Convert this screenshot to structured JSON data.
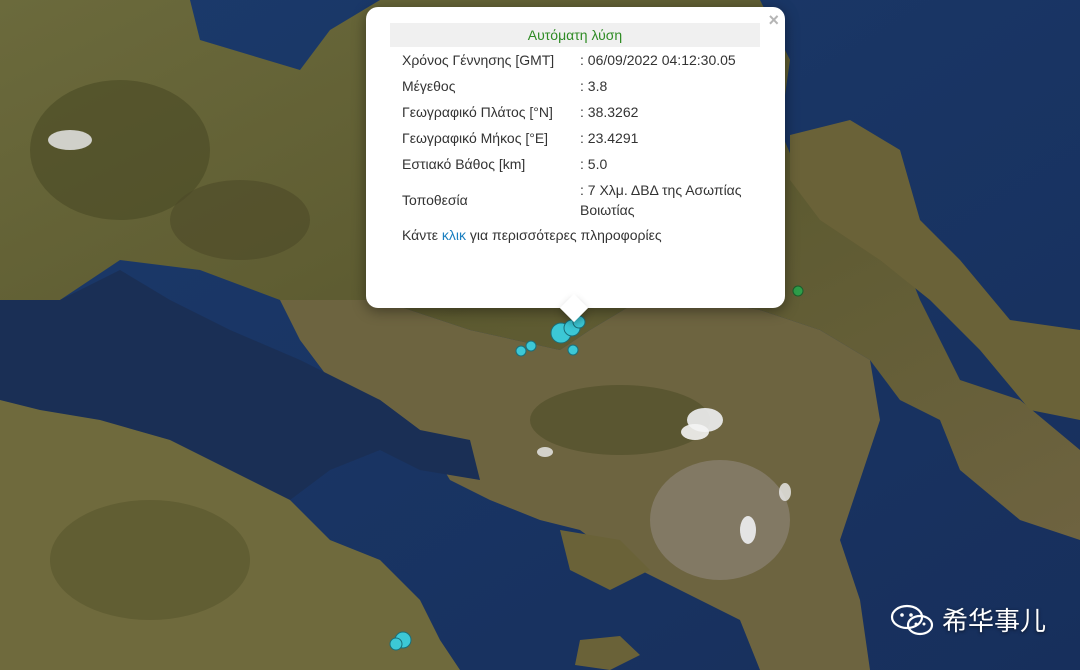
{
  "popup": {
    "header": "Αυτόματη λύση",
    "close_symbol": "×",
    "rows": [
      {
        "label": "Χρόνος Γέννησης [GMT]",
        "value": ": 06/09/2022 04:12:30.05"
      },
      {
        "label": "Μέγεθος",
        "value": ": 3.8"
      },
      {
        "label": "Γεωγραφικό Πλάτος [°N]",
        "value": ": 38.3262"
      },
      {
        "label": "Γεωγραφικό Μήκος [°E]",
        "value": ": 23.4291"
      },
      {
        "label": "Εστιακό Βάθος [km]",
        "value": ": 5.0"
      },
      {
        "label": "Τοποθεσία",
        "value": ": 7 Χλμ. ΔΒΔ της Ασωπίας Βοιωτίας"
      }
    ],
    "more_prefix": "Κάντε ",
    "more_link": "κλικ",
    "more_suffix": " για περισσότερες πληροφορίες"
  },
  "watermark": {
    "text": "希华事儿",
    "icon": "wechat-icon"
  },
  "colors": {
    "quake_marker": "#3cc8d6",
    "quake_marker_old": "#2e9e4a",
    "header_text": "#2e8b24",
    "link": "#1a7fc0",
    "sea": "#1d3a6a",
    "land": "#5a5a2e"
  }
}
